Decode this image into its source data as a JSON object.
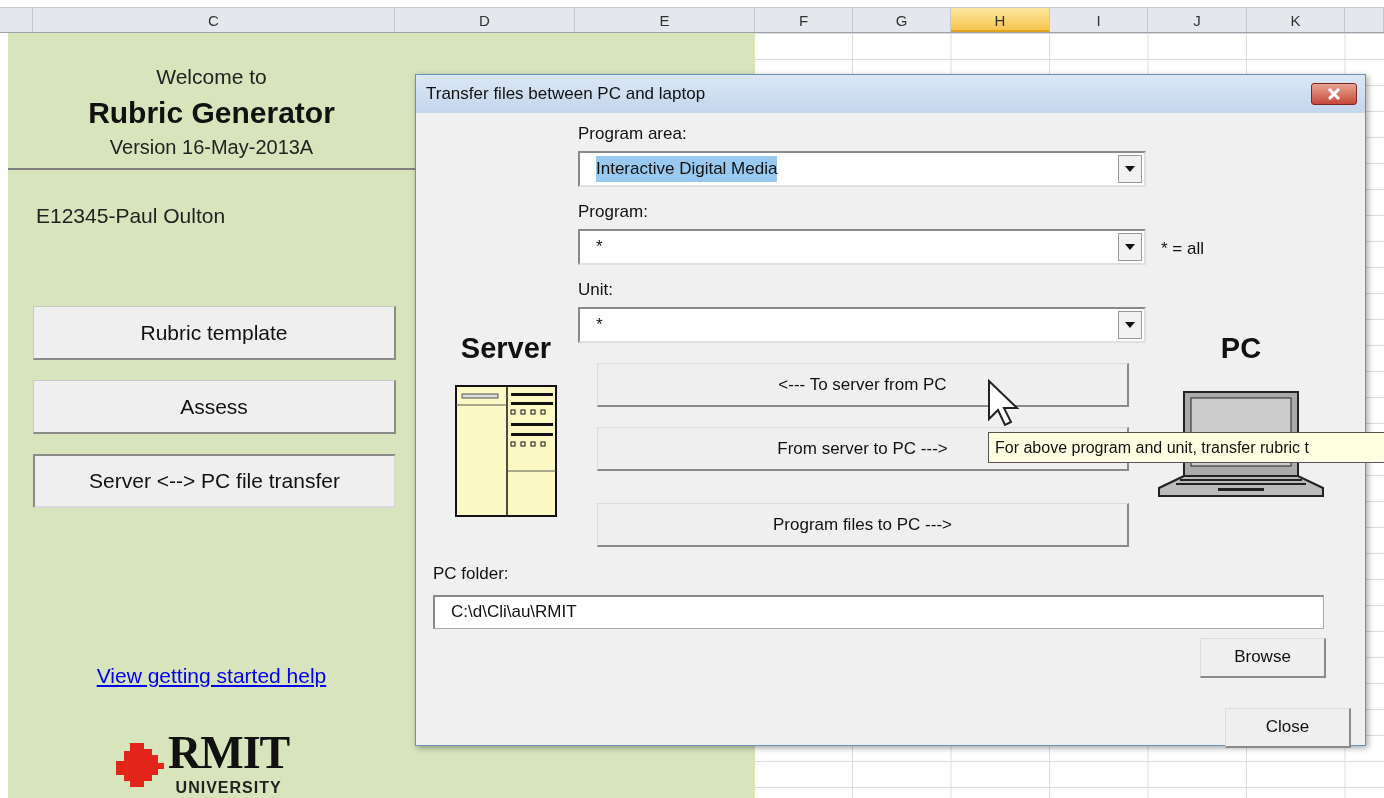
{
  "spreadsheet": {
    "columns": [
      {
        "label": "C",
        "selected": false
      },
      {
        "label": "D",
        "selected": false
      },
      {
        "label": "E",
        "selected": false
      },
      {
        "label": "F",
        "selected": false
      },
      {
        "label": "G",
        "selected": false
      },
      {
        "label": "H",
        "selected": true
      },
      {
        "label": "I",
        "selected": false
      },
      {
        "label": "J",
        "selected": false
      },
      {
        "label": "K",
        "selected": false
      }
    ]
  },
  "panel": {
    "welcome": "Welcome to",
    "title": "Rubric Generator",
    "version": "Version 16-May-2013A",
    "user": "E12345-Paul Oulton",
    "buttons": [
      {
        "label": "Rubric template",
        "pressed": false
      },
      {
        "label": "Assess",
        "pressed": false
      },
      {
        "label": "Server <--> PC file transfer",
        "pressed": true
      }
    ],
    "help_link": "View getting started help",
    "logo": {
      "name": "RMIT",
      "subtitle": "UNIVERSITY"
    }
  },
  "dialog": {
    "title": "Transfer files between PC and laptop",
    "fields": [
      {
        "label": "Program area:",
        "value": "Interactive Digital Media",
        "highlighted": true
      },
      {
        "label": "Program:",
        "value": "*",
        "highlighted": false,
        "note": "* = all"
      },
      {
        "label": "Unit:",
        "value": "*",
        "highlighted": false
      }
    ],
    "server_label": "Server",
    "pc_label": "PC",
    "actions": [
      "<--- To server from PC",
      "From server to PC --->",
      "Program files to PC --->"
    ],
    "folder": {
      "label": "PC folder:",
      "value": "C:\\d\\Cli\\au\\RMIT"
    },
    "browse": "Browse",
    "close": "Close",
    "tooltip": "For above program and unit, transfer rubric t"
  }
}
